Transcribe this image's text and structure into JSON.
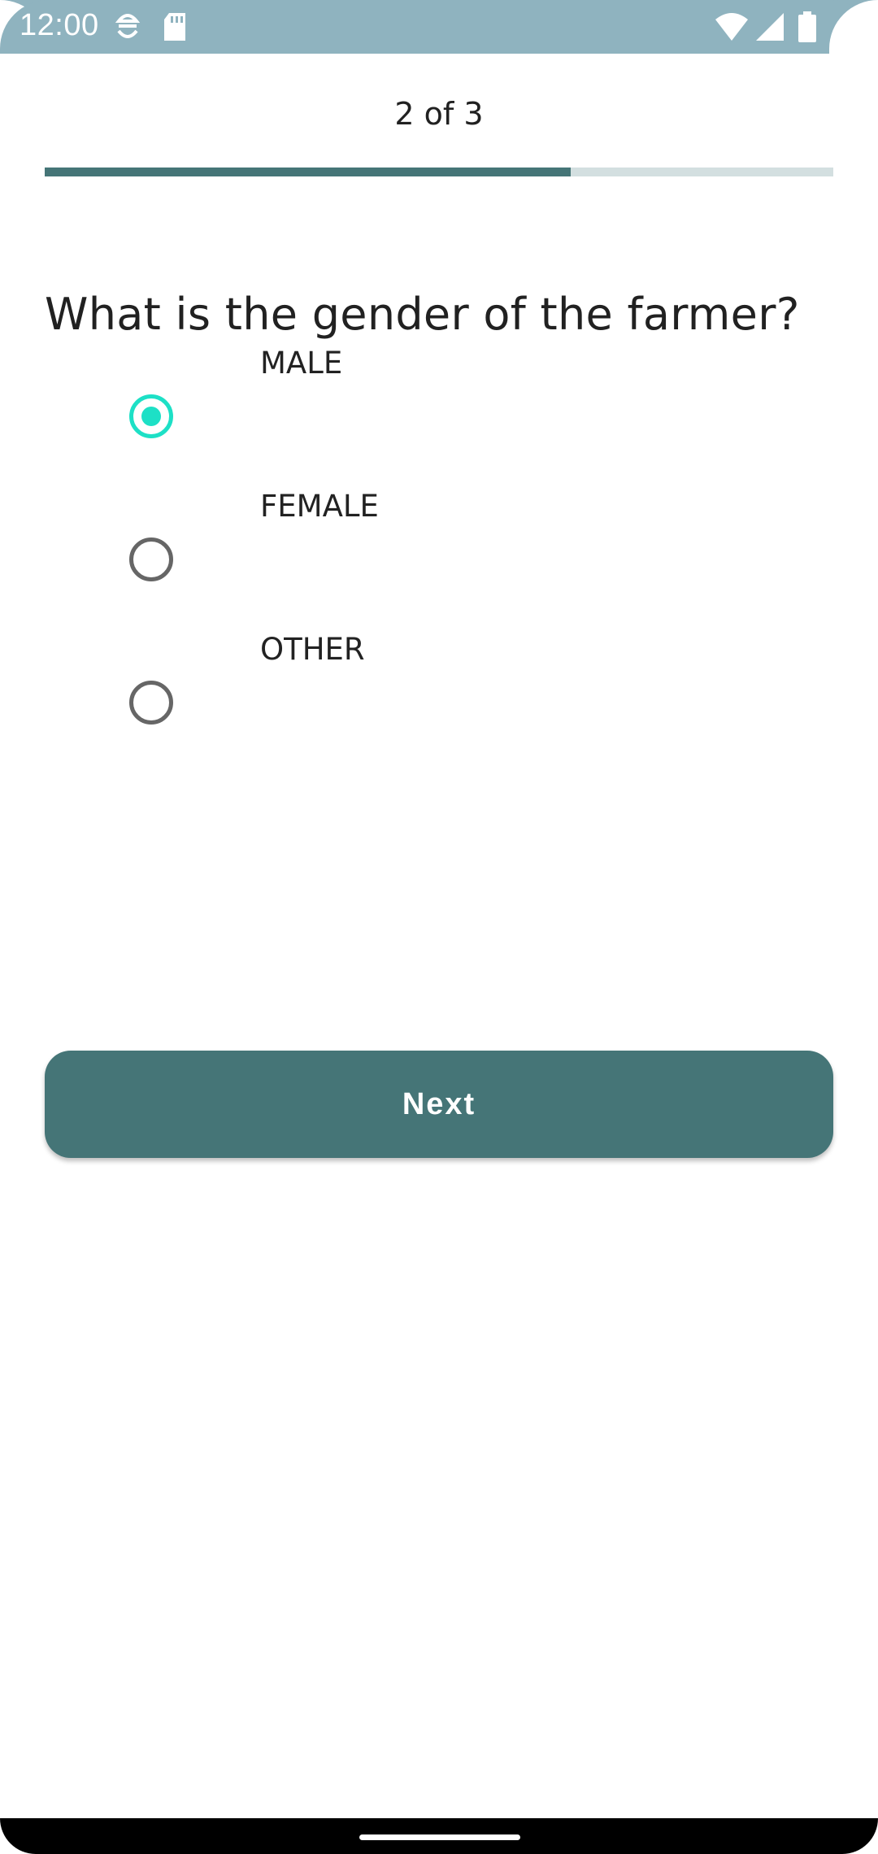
{
  "status_bar": {
    "time": "12:00",
    "left_icons": [
      "debug-icon",
      "sd-card-icon"
    ],
    "right_icons": [
      "wifi-icon",
      "signal-icon",
      "battery-icon"
    ]
  },
  "progress": {
    "text": "2 of 3",
    "fraction": 0.667,
    "fill_color": "#457577",
    "track_color": "#d3dfe0"
  },
  "question": "What is the gender of the farmer?",
  "options": [
    {
      "label": "MALE",
      "selected": true
    },
    {
      "label": "FEMALE",
      "selected": false
    },
    {
      "label": "OTHER",
      "selected": false
    }
  ],
  "accent_color": "#1de0c6",
  "next_button": {
    "label": "Next"
  }
}
